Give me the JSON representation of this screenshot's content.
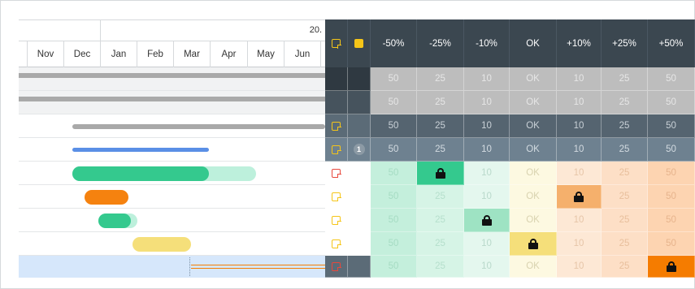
{
  "timeline": {
    "year_label": "20.",
    "months": [
      "Nov",
      "Dec",
      "Jan",
      "Feb",
      "Mar",
      "Apr",
      "May",
      "Jun"
    ]
  },
  "matrix": {
    "header_icons": [
      "note-outline-icon",
      "note-filled-icon"
    ],
    "columns": [
      "-50%",
      "-25%",
      "-10%",
      "OK",
      "+10%",
      "+25%",
      "+50%"
    ],
    "rows": [
      {
        "values": [
          "50",
          "25",
          "10",
          "OK",
          "10",
          "25",
          "50"
        ],
        "note": "none",
        "badge": "",
        "lock": -1
      },
      {
        "values": [
          "50",
          "25",
          "10",
          "OK",
          "10",
          "25",
          "50"
        ],
        "note": "none",
        "badge": "",
        "lock": -1
      },
      {
        "values": [
          "50",
          "25",
          "10",
          "OK",
          "10",
          "25",
          "50"
        ],
        "note": "yellow",
        "badge": "",
        "lock": -1
      },
      {
        "values": [
          "50",
          "25",
          "10",
          "OK",
          "10",
          "25",
          "50"
        ],
        "note": "yellow",
        "badge": "1",
        "lock": -1
      },
      {
        "values": [
          "50",
          "",
          "10",
          "OK",
          "10",
          "25",
          "50"
        ],
        "note": "red",
        "badge": "",
        "lock": 1
      },
      {
        "values": [
          "50",
          "25",
          "10",
          "OK",
          "",
          "25",
          "50"
        ],
        "note": "yellow",
        "badge": "",
        "lock": 4
      },
      {
        "values": [
          "50",
          "25",
          "",
          "OK",
          "10",
          "25",
          "50"
        ],
        "note": "yellow",
        "badge": "",
        "lock": 2
      },
      {
        "values": [
          "50",
          "25",
          "10",
          "",
          "10",
          "25",
          "50"
        ],
        "note": "yellow",
        "badge": "",
        "lock": 3
      },
      {
        "values": [
          "50",
          "25",
          "10",
          "OK",
          "10",
          "25",
          ""
        ],
        "note": "red",
        "badge": "",
        "lock": 6
      }
    ]
  },
  "colors": {
    "header_bg": "#3b4750",
    "summary_dark": "#2f3941",
    "summary_mid": "#46535d",
    "summary_light": "#5b6b77",
    "summary_lighter": "#6e8190",
    "bar_grey": "#a9a9a9",
    "bar_blue": "#5a8fe6",
    "bar_green": "#34c98e",
    "bar_green_light": "#bdf0dc",
    "bar_orange": "#f5820f",
    "bar_yellow": "#f5df7a",
    "selected_row": "#d6e7fb",
    "lock_orange": "#f57c00"
  }
}
